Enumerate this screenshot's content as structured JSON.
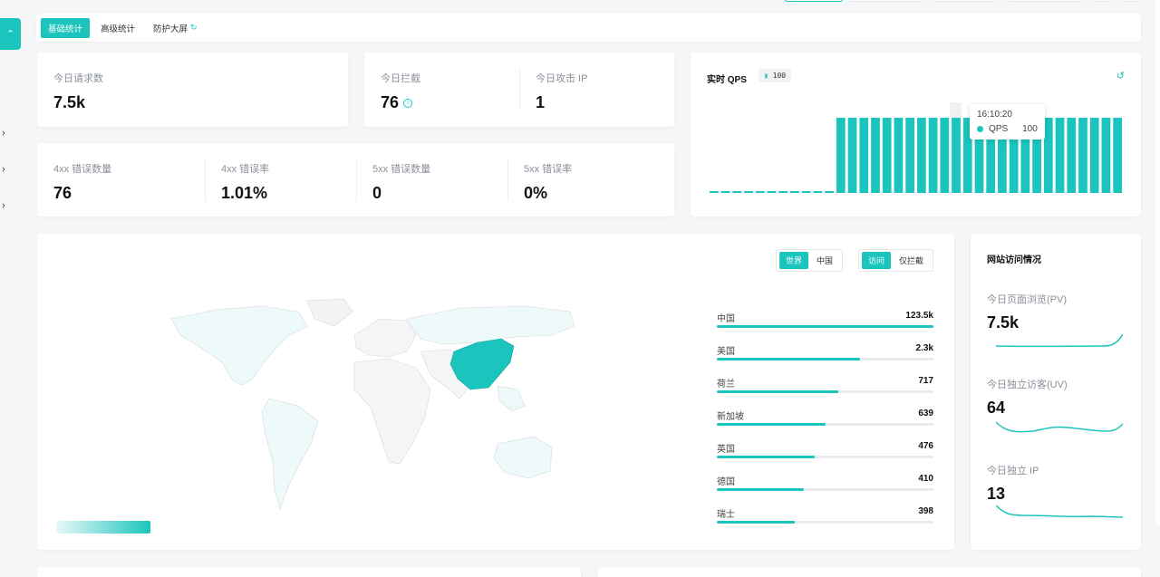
{
  "tabs": [
    {
      "label": "基础统计",
      "active": true
    },
    {
      "label": "高级统计",
      "active": false
    },
    {
      "label": "防护大屏",
      "active": false
    }
  ],
  "rail": {
    "collapse_icon": "chevron-up-icon"
  },
  "requests": {
    "label": "今日请求数",
    "value": "7.5k"
  },
  "blocks": {
    "label": "今日拦截",
    "value": "76"
  },
  "attack_ip": {
    "label": "今日攻击 IP",
    "value": "1"
  },
  "errors": [
    {
      "label": "4xx 错误数量",
      "value": "76"
    },
    {
      "label": "4xx 错误率",
      "value": "1.01%"
    },
    {
      "label": "5xx 错误数量",
      "value": "0"
    },
    {
      "label": "5xx 错误率",
      "value": "0%"
    }
  ],
  "qps": {
    "title": "实时 QPS",
    "badge": "100",
    "tooltip_time": "16:10:20",
    "tooltip_series": "QPS",
    "tooltip_value": "100"
  },
  "chart_data": {
    "type": "bar",
    "series": [
      {
        "name": "QPS",
        "values": [
          0,
          0,
          0,
          0,
          0,
          0,
          0,
          0,
          0,
          0,
          0,
          100,
          100,
          100,
          100,
          100,
          100,
          100,
          100,
          100,
          100,
          100,
          100,
          100,
          100,
          100,
          100,
          100,
          100,
          100,
          100,
          100,
          100,
          100,
          100,
          100
        ]
      }
    ],
    "ylim": [
      0,
      100
    ]
  },
  "map": {
    "scope_options": [
      {
        "label": "世界",
        "on": true
      },
      {
        "label": "中国",
        "on": false
      }
    ],
    "mode_options": [
      {
        "label": "访问",
        "on": true
      },
      {
        "label": "仅拦截",
        "on": false
      }
    ],
    "ranking": [
      {
        "name": "中国",
        "value": "123.5k",
        "ratio": 1.0
      },
      {
        "name": "美国",
        "value": "2.3k",
        "ratio": 0.66
      },
      {
        "name": "荷兰",
        "value": "717",
        "ratio": 0.56
      },
      {
        "name": "新加坡",
        "value": "639",
        "ratio": 0.5
      },
      {
        "name": "英国",
        "value": "476",
        "ratio": 0.45
      },
      {
        "name": "德国",
        "value": "410",
        "ratio": 0.4
      },
      {
        "name": "瑞士",
        "value": "398",
        "ratio": 0.36
      }
    ],
    "highlight_color": "#1bc4bd"
  },
  "visits": {
    "title": "网站访问情况",
    "pv": {
      "label": "今日页面浏览(PV)",
      "value": "7.5k"
    },
    "uv": {
      "label": "今日独立访客(UV)",
      "value": "64"
    },
    "ip": {
      "label": "今日独立 IP",
      "value": "13"
    }
  }
}
